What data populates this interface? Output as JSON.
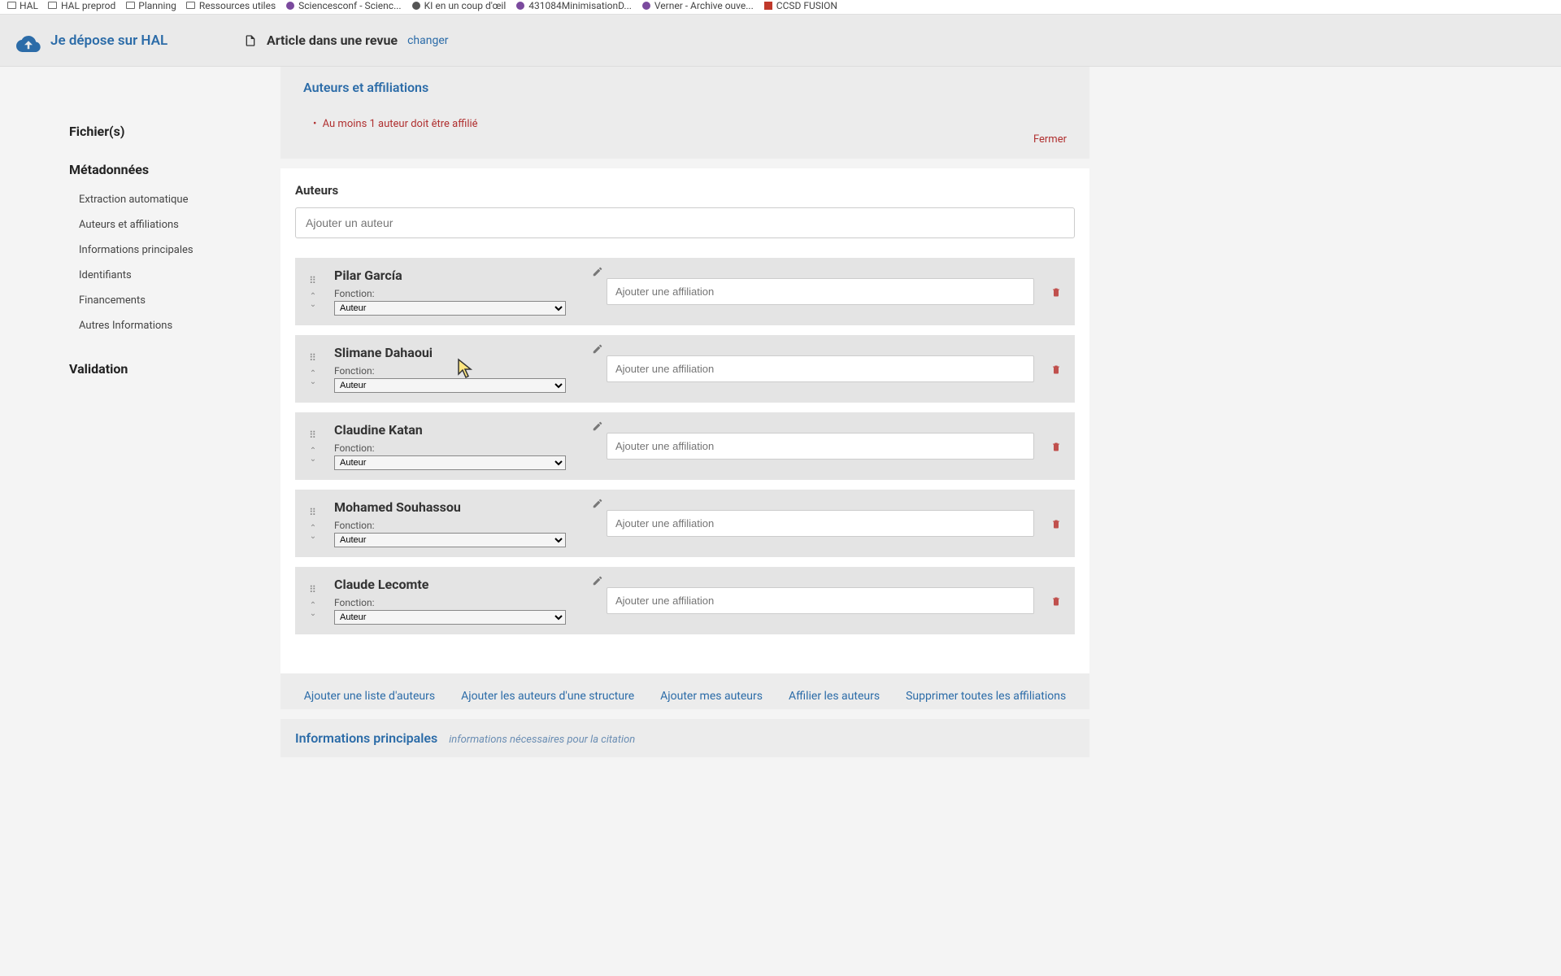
{
  "bookmarks": [
    {
      "label": "HAL",
      "icon": "folder"
    },
    {
      "label": "HAL preprod",
      "icon": "folder"
    },
    {
      "label": "Planning",
      "icon": "folder"
    },
    {
      "label": "Ressources utiles",
      "icon": "folder"
    },
    {
      "label": "Sciencesconf - Scienc...",
      "icon": "purple"
    },
    {
      "label": "KI en un coup d'œil",
      "icon": "dot"
    },
    {
      "label": "431084MinimisationD...",
      "icon": "purple"
    },
    {
      "label": "Verner - Archive ouve...",
      "icon": "purple"
    },
    {
      "label": "CCSD FUSION",
      "icon": "red"
    }
  ],
  "header": {
    "depose_label": "Je dépose sur HAL",
    "doc_type": "Article dans une revue",
    "change_label": "changer"
  },
  "sidebar": {
    "fichiers_title": "Fichier(s)",
    "metadonnees_title": "Métadonnées",
    "metadonnees_items": [
      "Extraction automatique",
      "Auteurs et affiliations",
      "Informations principales",
      "Identifiants",
      "Financements",
      "Autres Informations"
    ],
    "validation_title": "Validation"
  },
  "panel": {
    "aff_title": "Auteurs et affiliations",
    "warning": "Au moins 1 auteur doit être affilié",
    "fermer": "Fermer"
  },
  "authors_section": {
    "heading": "Auteurs",
    "add_placeholder": "Ajouter un auteur",
    "fonction_label": "Fonction:",
    "fonction_value": "Auteur",
    "affiliation_placeholder": "Ajouter une affiliation",
    "authors": [
      {
        "name": "Pilar García"
      },
      {
        "name": "Slimane Dahaoui"
      },
      {
        "name": "Claudine Katan"
      },
      {
        "name": "Mohamed Souhassou"
      },
      {
        "name": "Claude Lecomte"
      }
    ]
  },
  "actions": {
    "add_list": "Ajouter une liste d'auteurs",
    "add_structure": "Ajouter les auteurs d'une structure",
    "add_mine": "Ajouter mes auteurs",
    "affiliate": "Affilier les auteurs",
    "delete_all": "Supprimer toutes les affiliations"
  },
  "info_principales": {
    "title": "Informations principales",
    "subtitle": "informations nécessaires pour la citation"
  }
}
